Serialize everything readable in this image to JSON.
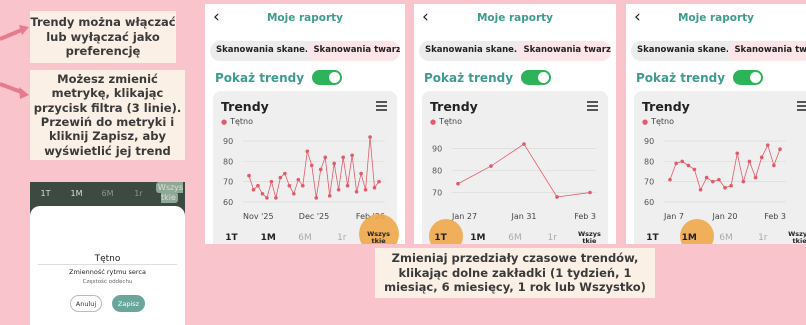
{
  "callouts": {
    "toggle": "Trendy można włączać lub wyłączać jako preferencję",
    "metric": "Możesz zmienić metrykę, klikając przycisk filtra (3 linie). Przewiń do metryki i kliknij Zapisz, aby wyświetlić jej trend",
    "range": "Zmieniaj przedziały czasowe trendów, klikając dolne zakładki (1 tydzień, 1 miesiąc, 6 miesięcy, 1 rok lub Wszystko)"
  },
  "colors": {
    "background": "#f9c4cc",
    "accent": "#3d9c8e",
    "toggle_on": "#2db359",
    "series": "#e05c6c",
    "highlight": "#f0a74a"
  },
  "sheet": {
    "tabs": [
      "1T",
      "1M",
      "6M",
      "1r",
      "Wszys tkie"
    ],
    "metric": "Tętno",
    "option1": "Zmienność rytmu serca",
    "option2": "Częstość oddechu",
    "cancel": "Anuluj",
    "save": "Zapisz"
  },
  "phones": [
    {
      "back": "‹",
      "title": "Moje raporty",
      "seg_left": "Skanowania skane...",
      "seg_right": "Skanowania twarzy",
      "trends_label": "Pokaż trendy",
      "card_title": "Trendy",
      "legend": "Tętno",
      "tabs": [
        "1T",
        "1M",
        "6M",
        "1r",
        "Wszys tkie"
      ],
      "active_tab": 4,
      "x_ticks": [
        "Nov '25",
        "Dec '25",
        "Feb '26"
      ]
    },
    {
      "back": "‹",
      "title": "Moje raporty",
      "seg_left": "Skanowania skane...",
      "seg_right": "Skanowania twarzy",
      "trends_label": "Pokaż trendy",
      "card_title": "Trendy",
      "legend": "Tętno",
      "tabs": [
        "1T",
        "1M",
        "6M",
        "1r",
        "Wszys tkie"
      ],
      "active_tab": 0,
      "x_ticks": [
        "Jan 27",
        "Jan 31",
        "Feb 3"
      ]
    },
    {
      "back": "‹",
      "title": "Moje raporty",
      "seg_left": "Skanowania skane...",
      "seg_right": "Skanowania twarzy",
      "trends_label": "Pokaż trendy",
      "card_title": "Trendy",
      "legend": "Tętno",
      "tabs": [
        "1T",
        "1M",
        "6M",
        "1r",
        "Wszys tkie"
      ],
      "active_tab": 1,
      "x_ticks": [
        "Jan 7",
        "Jan 20",
        "Feb 3"
      ]
    }
  ],
  "chart_data": [
    {
      "type": "line",
      "series": [
        {
          "name": "Tętno",
          "values": [
            73,
            66,
            68,
            64,
            62,
            70,
            62,
            72,
            74,
            68,
            64,
            71,
            68,
            85,
            78,
            62,
            76,
            82,
            63,
            79,
            66,
            82,
            68,
            83,
            65,
            74,
            66,
            92,
            67,
            70
          ]
        }
      ],
      "x": [
        "Nov '25",
        "Dec '25",
        "Feb '26"
      ],
      "ylim": [
        57,
        94
      ],
      "yticks": [
        60,
        70,
        80,
        90
      ]
    },
    {
      "type": "line",
      "series": [
        {
          "name": "Tętno",
          "values": [
            74,
            82,
            92,
            68,
            70
          ]
        }
      ],
      "x": [
        "Jan 27",
        "Jan 31",
        "Feb 3"
      ],
      "ylim": [
        63,
        97
      ],
      "yticks": [
        70,
        80,
        90
      ]
    },
    {
      "type": "line",
      "series": [
        {
          "name": "Tętno",
          "values": [
            71,
            79,
            80,
            78,
            76,
            66,
            72,
            70,
            71,
            67,
            68,
            84,
            70,
            80,
            72,
            82,
            88,
            78,
            86
          ]
        }
      ],
      "x": [
        "Jan 7",
        "Jan 20",
        "Feb 3"
      ],
      "ylim": [
        57,
        94
      ],
      "yticks": [
        60,
        70,
        80,
        90
      ]
    }
  ]
}
